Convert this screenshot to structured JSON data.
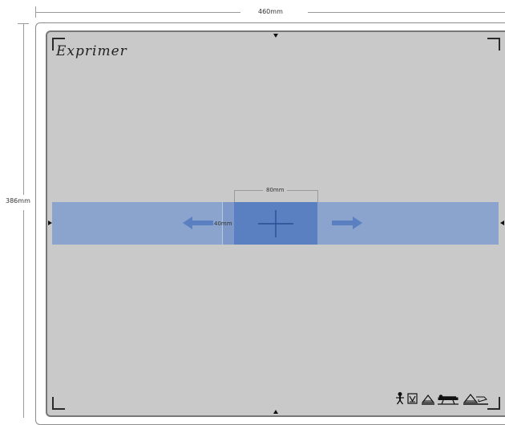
{
  "dimensions": {
    "width_label": "460mm",
    "height_label": "386mm",
    "center_width_label": "80mm",
    "center_height_label": "40mm"
  },
  "brand": {
    "logo_text": "Exprimer"
  },
  "colors": {
    "panel": "#c9c9c9",
    "band": "#8ba4cd",
    "center": "#5b80c2",
    "arrow": "#5b80c2",
    "crosshair": "#284f92"
  },
  "icons": [
    "person-icon",
    "detector-icon",
    "table-icon",
    "table-patient-icon",
    "table-warning-icon"
  ]
}
